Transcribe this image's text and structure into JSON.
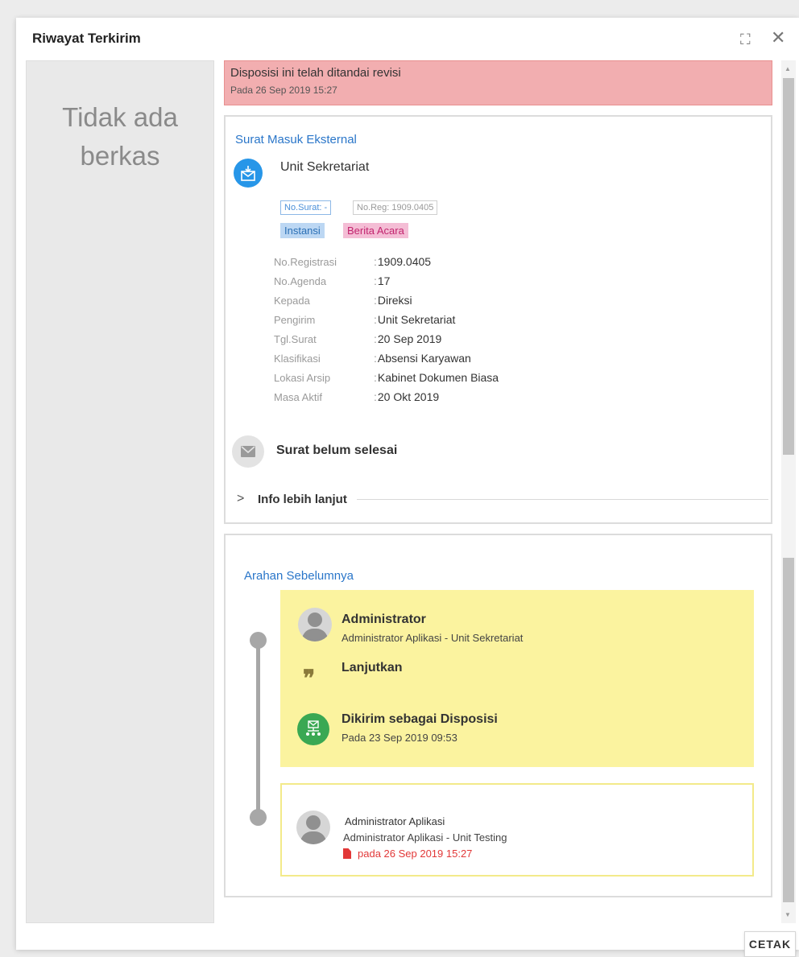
{
  "dialog": {
    "title": "Riwayat Terkirim",
    "expand_icon": "expand-icon",
    "close_icon": "close-icon"
  },
  "file_panel": {
    "empty_text": "Tidak ada\nberkas"
  },
  "revisi_banner": {
    "title": "Disposisi ini telah ditandai revisi",
    "date": "Pada 26 Sep 2019 15:27",
    "color": "#f2aeb0"
  },
  "surat": {
    "type_label": "Surat Masuk Eksternal",
    "unit_name": "Unit Sekretariat",
    "icon": "inbox-mail-icon",
    "tags": {
      "no_surat": "No.Surat: -",
      "no_reg": "No.Reg: 1909.0405",
      "instansi": "Instansi",
      "kategori": "Berita Acara"
    },
    "meta": [
      {
        "key": "No.Registrasi",
        "value": "1909.0405"
      },
      {
        "key": "No.Agenda",
        "value": "17"
      },
      {
        "key": "Kepada",
        "value": "Direksi"
      },
      {
        "key": "Pengirim",
        "value": "Unit Sekretariat"
      },
      {
        "key": "Tgl.Surat",
        "value": "20 Sep 2019"
      },
      {
        "key": "Klasifikasi",
        "value": "Absensi Karyawan"
      },
      {
        "key": "Lokasi Arsip",
        "value": "Kabinet Dokumen Biasa"
      },
      {
        "key": "Masa Aktif",
        "value": "20 Okt 2019"
      }
    ],
    "status": "Surat belum selesai",
    "more_info": "Info lebih lanjut"
  },
  "arahan": {
    "title": "Arahan Sebelumnya",
    "entries": [
      {
        "name": "Administrator",
        "role": "Administrator Aplikasi - Unit Sekretariat",
        "message": "Lanjutkan",
        "action": "Dikirim sebagai Disposisi",
        "date": "Pada 23 Sep 2019 09:53"
      },
      {
        "name": "Administrator Aplikasi",
        "role": "Administrator Aplikasi - Unit Testing",
        "date": "pada 26 Sep 2019 15:27"
      }
    ]
  },
  "footer": {
    "print_label": "CETAK"
  }
}
